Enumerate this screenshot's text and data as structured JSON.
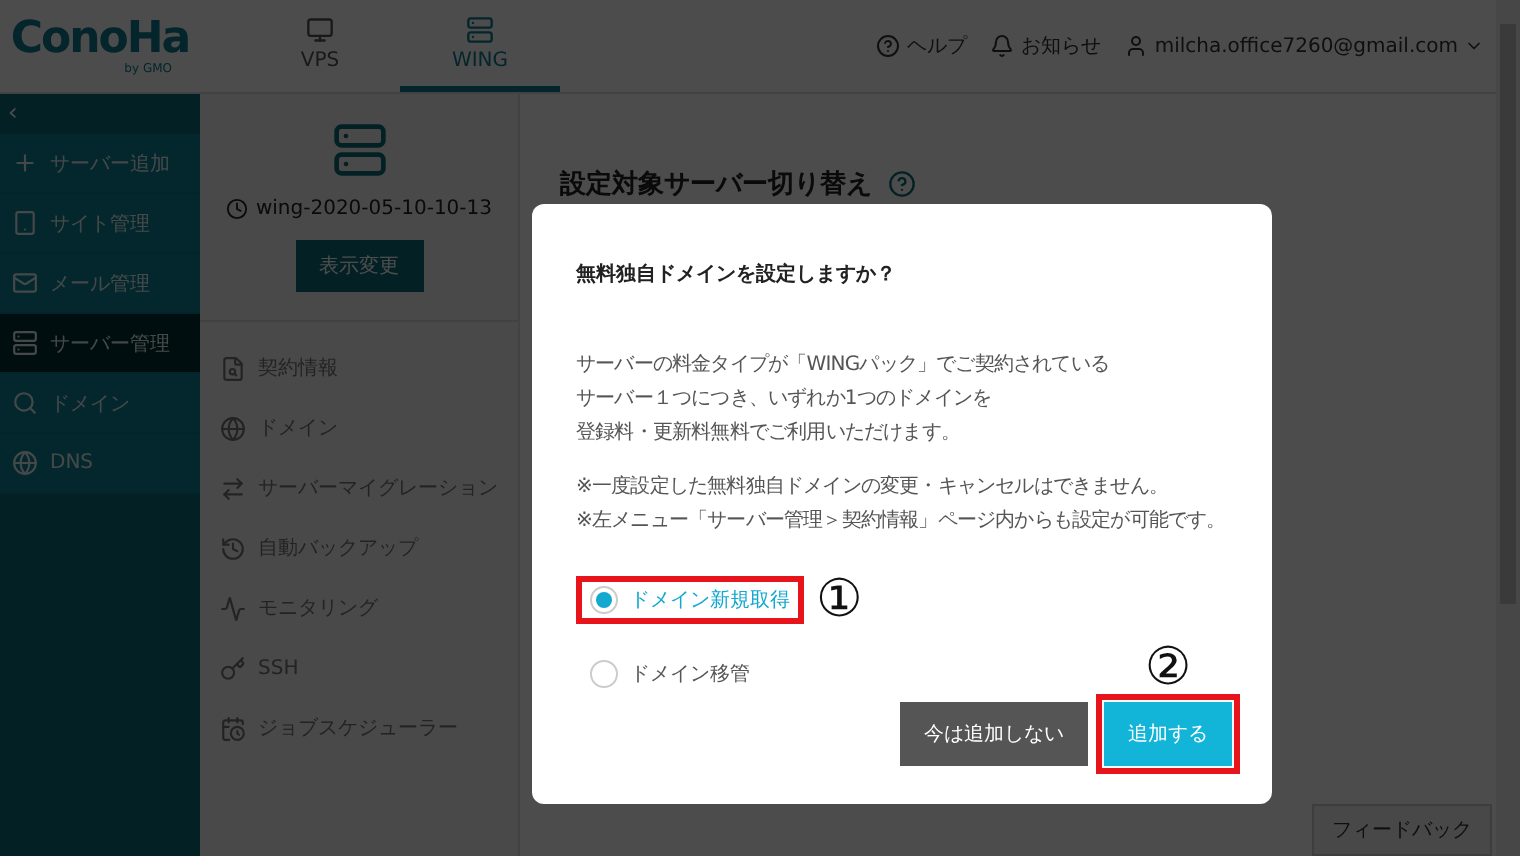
{
  "header": {
    "logo": "ConoHa",
    "logo_sub": "by GMO",
    "tabs": [
      {
        "kind": "vps",
        "label": "VPS",
        "selected": false
      },
      {
        "kind": "wing",
        "label": "WING",
        "selected": true
      }
    ],
    "links": [
      {
        "kind": "help",
        "label": "ヘルプ"
      },
      {
        "kind": "notice",
        "label": "お知らせ"
      },
      {
        "kind": "account",
        "label": "milcha.office7260@gmail.com"
      }
    ]
  },
  "sidebar": {
    "collapse": "‹",
    "items": [
      {
        "kind": "add",
        "label": "サーバー追加",
        "selected": false
      },
      {
        "kind": "site",
        "label": "サイト管理",
        "selected": false
      },
      {
        "kind": "mail",
        "label": "メール管理",
        "selected": false
      },
      {
        "kind": "server",
        "label": "サーバー管理",
        "selected": true
      },
      {
        "kind": "domain",
        "label": "ドメイン",
        "selected": false
      },
      {
        "kind": "dns",
        "label": "DNS",
        "selected": false
      }
    ]
  },
  "server_panel": {
    "name": "wing-2020-05-10-10-13",
    "button": "表示変更",
    "menu": [
      {
        "kind": "contract",
        "label": "契約情報"
      },
      {
        "kind": "domain",
        "label": "ドメイン"
      },
      {
        "kind": "migration",
        "label": "サーバーマイグレーション"
      },
      {
        "kind": "backup",
        "label": "自動バックアップ"
      },
      {
        "kind": "monitoring",
        "label": "モニタリング"
      },
      {
        "kind": "ssh",
        "label": "SSH"
      },
      {
        "kind": "scheduler",
        "label": "ジョブスケジューラー"
      }
    ]
  },
  "main": {
    "title": "設定対象サーバー切り替え"
  },
  "feedback": "フィードバック",
  "dialog": {
    "title": "無料独自ドメインを設定しますか？",
    "paragraphs": [
      [
        "サーバーの料金タイプが「WINGパック」でご契約されている",
        "サーバー１つにつき、いずれか1つのドメインを",
        "登録料・更新料無料でご利用いただけます。"
      ],
      [
        "※一度設定した無料独自ドメインの変更・キャンセルはできません。",
        "※左メニュー「サーバー管理＞契約情報」ページ内からも設定が可能です。"
      ]
    ],
    "options": [
      {
        "label": "ドメイン新規取得",
        "selected": true,
        "annotation": "①"
      },
      {
        "label": "ドメイン移管",
        "selected": false
      }
    ],
    "buttons": [
      {
        "kind": "secondary",
        "label": "今は追加しない"
      },
      {
        "kind": "primary",
        "label": "追加する",
        "annotation": "②"
      }
    ]
  }
}
